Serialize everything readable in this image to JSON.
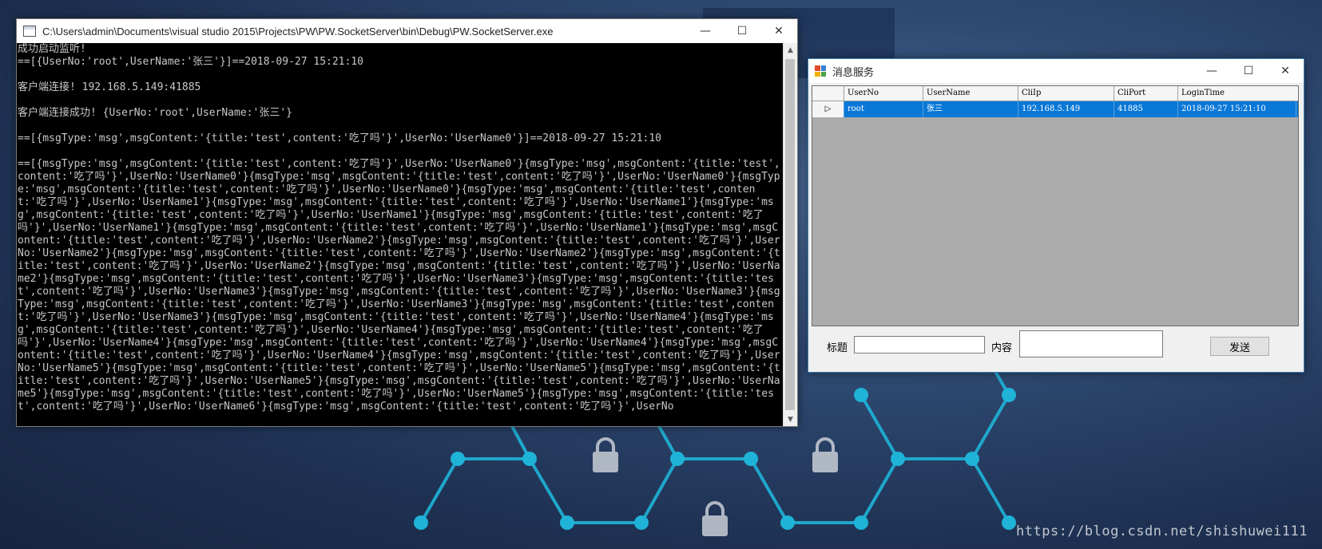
{
  "console": {
    "title": "C:\\Users\\admin\\Documents\\visual studio 2015\\Projects\\PW\\PW.SocketServer\\bin\\Debug\\PW.SocketServer.exe",
    "controls": {
      "minimize": "—",
      "maximize": "☐",
      "close": "✕"
    },
    "lines": [
      "成功启动监听!",
      "==[{UserNo:'root',UserName:'张三'}]==2018-09-27 15:21:10",
      "",
      "客户端连接! 192.168.5.149:41885",
      "",
      "客户端连接成功! {UserNo:'root',UserName:'张三'}",
      "",
      "==[{msgType:'msg',msgContent:'{title:'test',content:'吃了吗'}',UserNo:'UserName0'}]==2018-09-27 15:21:10",
      ""
    ],
    "stream": "==[{msgType:'msg',msgContent:'{title:'test',content:'吃了吗'}',UserNo:'UserName0'}{msgType:'msg',msgContent:'{title:'test',content:'吃了吗'}',UserNo:'UserName0'}{msgType:'msg',msgContent:'{title:'test',content:'吃了吗'}',UserNo:'UserName0'}{msgType:'msg',msgContent:'{title:'test',content:'吃了吗'}',UserNo:'UserName0'}{msgType:'msg',msgContent:'{title:'test',content:'吃了吗'}',UserNo:'UserName1'}{msgType:'msg',msgContent:'{title:'test',content:'吃了吗'}',UserNo:'UserName1'}{msgType:'msg',msgContent:'{title:'test',content:'吃了吗'}',UserNo:'UserName1'}{msgType:'msg',msgContent:'{title:'test',content:'吃了吗'}',UserNo:'UserName1'}{msgType:'msg',msgContent:'{title:'test',content:'吃了吗'}',UserNo:'UserName1'}{msgType:'msg',msgContent:'{title:'test',content:'吃了吗'}',UserNo:'UserName2'}{msgType:'msg',msgContent:'{title:'test',content:'吃了吗'}',UserNo:'UserName2'}{msgType:'msg',msgContent:'{title:'test',content:'吃了吗'}',UserNo:'UserName2'}{msgType:'msg',msgContent:'{title:'test',content:'吃了吗'}',UserNo:'UserName2'}{msgType:'msg',msgContent:'{title:'test',content:'吃了吗'}',UserNo:'UserName2'}{msgType:'msg',msgContent:'{title:'test',content:'吃了吗'}',UserNo:'UserName3'}{msgType:'msg',msgContent:'{title:'test',content:'吃了吗'}',UserNo:'UserName3'}{msgType:'msg',msgContent:'{title:'test',content:'吃了吗'}',UserNo:'UserName3'}{msgType:'msg',msgContent:'{title:'test',content:'吃了吗'}',UserNo:'UserName3'}{msgType:'msg',msgContent:'{title:'test',content:'吃了吗'}',UserNo:'UserName3'}{msgType:'msg',msgContent:'{title:'test',content:'吃了吗'}',UserNo:'UserName4'}{msgType:'msg',msgContent:'{title:'test',content:'吃了吗'}',UserNo:'UserName4'}{msgType:'msg',msgContent:'{title:'test',content:'吃了吗'}',UserNo:'UserName4'}{msgType:'msg',msgContent:'{title:'test',content:'吃了吗'}',UserNo:'UserName4'}{msgType:'msg',msgContent:'{title:'test',content:'吃了吗'}',UserNo:'UserName4'}{msgType:'msg',msgContent:'{title:'test',content:'吃了吗'}',UserNo:'UserName5'}{msgType:'msg',msgContent:'{title:'test',content:'吃了吗'}',UserNo:'UserName5'}{msgType:'msg',msgContent:'{title:'test',content:'吃了吗'}',UserNo:'UserName5'}{msgType:'msg',msgContent:'{title:'test',content:'吃了吗'}',UserNo:'UserName5'}{msgType:'msg',msgContent:'{title:'test',content:'吃了吗'}',UserNo:'UserName5'}{msgType:'msg',msgContent:'{title:'test',content:'吃了吗'}',UserNo:'UserName6'}{msgType:'msg',msgContent:'{title:'test',content:'吃了吗'}',UserNo"
  },
  "msg_window": {
    "title": "消息服务",
    "controls": {
      "minimize": "—",
      "maximize": "☐",
      "close": "✕"
    },
    "columns": [
      "",
      "UserNo",
      "UserName",
      "CliIp",
      "CliPort",
      "LoginTime"
    ],
    "rows": [
      {
        "indicator": "▷",
        "UserNo": "root",
        "UserName": "张三",
        "CliIp": "192.168.5.149",
        "CliPort": "41885",
        "LoginTime": "2018-09-27 15:21:10"
      }
    ],
    "title_label": "标题",
    "title_value": "",
    "content_label": "内容",
    "content_value": "",
    "send_label": "发送",
    "selection_color": "#0a78d7"
  },
  "watermark": "https://blog.csdn.net/shishuwei111",
  "theme": {
    "accent_cyan": "#1fb3d8",
    "console_bg": "#000000",
    "console_text": "#c8c8c8"
  }
}
